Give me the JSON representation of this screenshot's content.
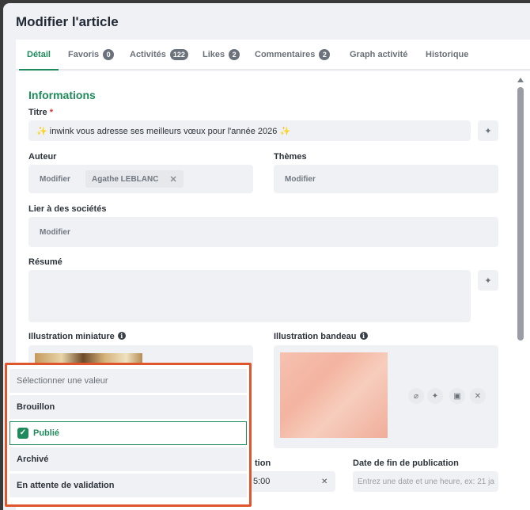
{
  "modal": {
    "title": "Modifier l'article"
  },
  "tabs": [
    {
      "label": "Détail",
      "badge": null
    },
    {
      "label": "Favoris",
      "badge": "0"
    },
    {
      "label": "Activités",
      "badge": "122"
    },
    {
      "label": "Likes",
      "badge": "2"
    },
    {
      "label": "Commentaires",
      "badge": "2"
    },
    {
      "label": "Graph activité",
      "badge": null
    },
    {
      "label": "Historique",
      "badge": null
    }
  ],
  "form": {
    "section_title": "Informations",
    "title_label": "Titre",
    "title_required": "*",
    "title_value": "✨ inwink vous adresse ses meilleurs vœux pour l'année 2026 ✨",
    "author_label": "Auteur",
    "author_modify": "Modifier",
    "author_chip": "Agathe LEBLANC",
    "themes_label": "Thèmes",
    "themes_modify": "Modifier",
    "companies_label": "Lier à des sociétés",
    "companies_modify": "Modifier",
    "summary_label": "Résumé",
    "thumb_label": "Illustration miniature",
    "banner_label": "Illustration bandeau",
    "pub_start_partial": "tion",
    "pub_start_value_partial": "5:00",
    "pub_end_label": "Date de fin de publication",
    "pub_end_placeholder": "Entrez une date et une heure, ex: 21 ja"
  },
  "dropdown": {
    "placeholder": "Sélectionner une valeur",
    "options": [
      "Brouillon",
      "Publié",
      "Archivé",
      "En attente de validation"
    ],
    "selected": "Publié"
  },
  "colors": {
    "accent": "#1f8a5b",
    "highlight": "#e0562c"
  }
}
